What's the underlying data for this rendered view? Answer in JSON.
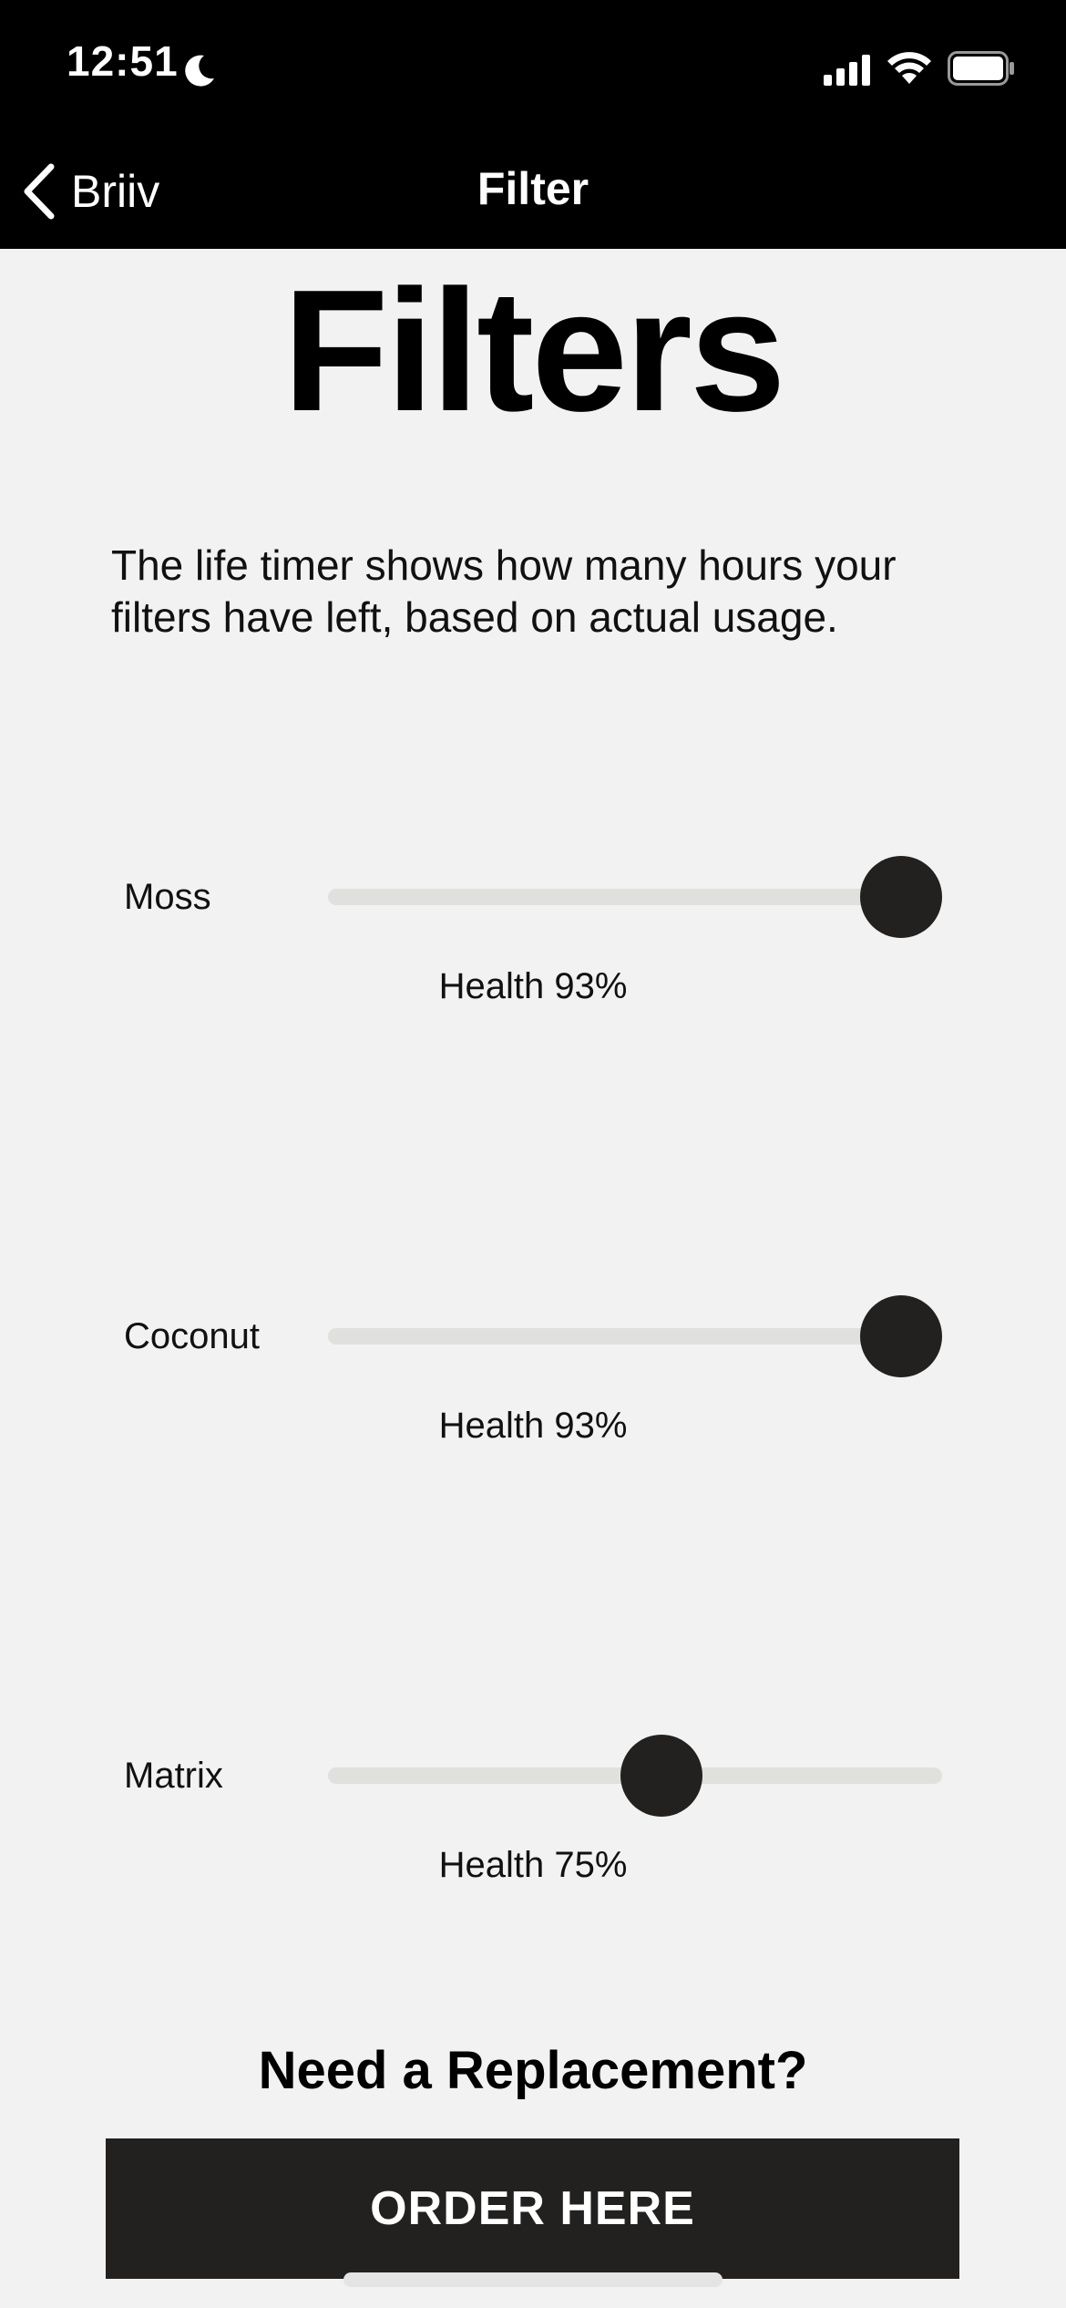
{
  "status_bar": {
    "time": "12:51",
    "icons": [
      "moon-icon",
      "cellular-signal-icon",
      "wifi-icon",
      "battery-icon"
    ]
  },
  "nav": {
    "back_label": "Briiv",
    "title": "Filter"
  },
  "page": {
    "title": "Filters",
    "intro": "The life timer shows how many hours your filters have left, based on actual usage."
  },
  "filters": [
    {
      "name": "Moss",
      "health_label": "Health 93%",
      "health_value": 0.93
    },
    {
      "name": "Coconut",
      "health_label": "Health 93%",
      "health_value": 0.93
    },
    {
      "name": "Matrix",
      "health_label": "Health 75%",
      "health_value": 0.75
    }
  ],
  "replacement": {
    "heading": "Need a Replacement?",
    "button_label": "ORDER HERE"
  },
  "colors": {
    "bar_background": "#000000",
    "page_background": "#f2f2f2",
    "track": "#e0e0de",
    "thumb": "#222120",
    "button": "#222120"
  }
}
